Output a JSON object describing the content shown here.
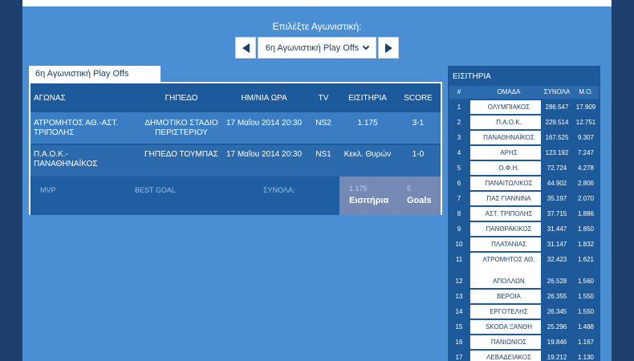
{
  "selector": {
    "title": "Επιλέξτε Αγωνιστική:",
    "current_round": "6η Αγωνιστική Play Offs"
  },
  "matches_panel": {
    "tab_label": "6η Αγωνιστική Play Offs",
    "headers": {
      "match": "ΑΓΩΝΑΣ",
      "stadium": "ΓΗΠΕΔΟ",
      "date": "ΗΜ/ΝΙΑ ΩΡΑ",
      "tv": "TV",
      "tickets": "ΕΙΣΙΤΗΡΙΑ",
      "score": "SCORE"
    },
    "rows": [
      {
        "match": "ΑΤΡΟΜΗΤΟΣ ΑΘ.-ΑΣΤ. ΤΡΙΠΟΛΗΣ",
        "stadium": "ΔΗΜΟΤΙΚΟ ΣΤΑΔΙΟ ΠΕΡΙΣΤΕΡΙΟΥ",
        "date": "17 Μαΐου 2014 20:30",
        "tv": "NS2",
        "tickets": "1.175",
        "score": "3-1"
      },
      {
        "match": "Π.Α.Ο.Κ.-ΠΑΝΑΘΗΝΑΪΚΟΣ",
        "stadium": "ΓΗΠΕΔΟ ΤΟΥΜΠΑΣ",
        "date": "17 Μαΐου 2014 20:30",
        "tv": "NS1",
        "tickets": "Κεκλ. Θυρών",
        "score": "1-0"
      }
    ],
    "summary": {
      "mvp_label": "MVP",
      "best_goal_label": "BEST GOAL",
      "totals_label": "ΣΥΝΟΛΑ:",
      "tickets_value": "1.175",
      "tickets_label": "Εισιτήρια",
      "goals_value": "5",
      "goals_label": "Goals"
    }
  },
  "tickets_panel": {
    "title": "ΕΙΣΙΤΗΡΙΑ",
    "headers": {
      "rank": "#",
      "team": "ΟΜΑΔΑ",
      "total": "ΣΥΝΟΛΑ",
      "avg": "Μ.Ο."
    },
    "rows": [
      {
        "rank": "1",
        "team": "ΟΛΥΜΠΙΑΚΟΣ",
        "total": "286.547",
        "avg": "17.909"
      },
      {
        "rank": "2",
        "team": "Π.Α.Ο.Κ.",
        "total": "229.514",
        "avg": "12.751"
      },
      {
        "rank": "3",
        "team": "ΠΑΝΑΘΗΝΑΪΚΟΣ",
        "total": "167.525",
        "avg": "9.307"
      },
      {
        "rank": "4",
        "team": "ΑΡΗΣ",
        "total": "123.192",
        "avg": "7.247"
      },
      {
        "rank": "5",
        "team": "Ο.Φ.Η.",
        "total": "72.724",
        "avg": "4.278"
      },
      {
        "rank": "6",
        "team": "ΠΑΝΑΙΤΩΛΙΚΟΣ",
        "total": "44.902",
        "avg": "2.806"
      },
      {
        "rank": "7",
        "team": "ΠΑΣ ΓΙΑΝΝΙΝΑ",
        "total": "35.197",
        "avg": "2.070"
      },
      {
        "rank": "8",
        "team": "ΑΣΤ. ΤΡΙΠΟΛΗΣ",
        "total": "37.715",
        "avg": "1.886"
      },
      {
        "rank": "9",
        "team": "ΠΑΝΘΡΑΚΙΚΟΣ",
        "total": "31.447",
        "avg": "1.850"
      },
      {
        "rank": "10",
        "team": "ΠΛΑΤΑΝΙΑΣ",
        "total": "31.147",
        "avg": "1.832"
      },
      {
        "rank": "11",
        "team": "ΑΤΡΟΜΗΤΟΣ ΑΘ.",
        "total": "32.423",
        "avg": "1.621"
      },
      {
        "rank": "12",
        "team": "ΑΠΟΛΛΩΝ",
        "total": "26.528",
        "avg": "1.560"
      },
      {
        "rank": "13",
        "team": "ΒΕΡΟΙΑ",
        "total": "26.355",
        "avg": "1.550"
      },
      {
        "rank": "14",
        "team": "ΕΡΓΟΤΕΛΗΣ",
        "total": "26.345",
        "avg": "1.550"
      },
      {
        "rank": "15",
        "team": "SKODA ΞΑΝΘΗ",
        "total": "25.296",
        "avg": "1.488"
      },
      {
        "rank": "16",
        "team": "ΠΑΝΙΩΝΙΟΣ",
        "total": "19.846",
        "avg": "1.167"
      },
      {
        "rank": "17",
        "team": "ΛΕΒΑΔΕΙΑΚΟΣ",
        "total": "19.212",
        "avg": "1.130"
      }
    ]
  },
  "colors": {
    "page_bg": "#4a8fd4",
    "outer_bg": "#1c3f6e",
    "panel_dark": "#1e5a9a",
    "row_light": "#3b7dc3",
    "totals_box": "#7489b3"
  }
}
